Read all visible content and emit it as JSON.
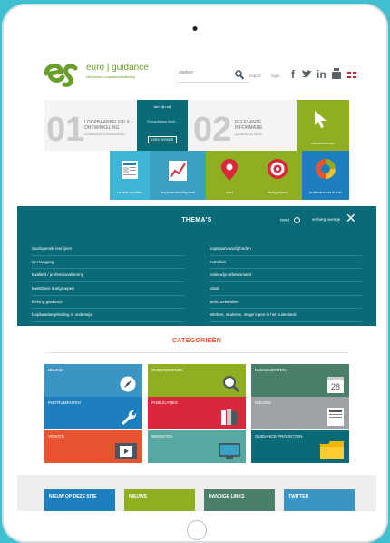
{
  "header": {
    "logo_brand": "euro",
    "logo_brand2": "guidance",
    "logo_sub": "Nederlands Loopbaanontwikkeling",
    "search_placeholder": "zoeken",
    "nav_export": "export",
    "nav_login": "login",
    "social": [
      "f",
      "t",
      "in",
      "yt"
    ]
  },
  "hero": {
    "num1": "01",
    "label1": "LOOPBAANBELEID & -ONTWIKKELING",
    "sub1": "Ontwikkelingen in loopbaanbeleid",
    "who_title": "wie zijn wij",
    "who_text": "Euroguidance biedt...",
    "read_more": "LEES VERDER",
    "num2": "02",
    "label2": "RELEVANTE INFORMATIE",
    "sub2": "gerelateerd per thema",
    "tile_nieuws": "nieuwsbrieven",
    "tile_updates": "Laatste updates",
    "tile_chart": "loopbaankennisportal",
    "tile_pin": "doel",
    "tile_target": "doelgroepen",
    "tile_ring": "professioneel in info"
  },
  "themas": {
    "title": "THEMA'S",
    "reset": "reset",
    "hide": "verberg overige",
    "left": [
      "doorlopende leerlijnen",
      "ict / toegang",
      "kwaliteit / professionalisering",
      "kwetsbare doelgroepen",
      "lifelong guidance",
      "loopbaanbegeleiding in onderwijs"
    ],
    "right": [
      "loopbaanvaardigheden",
      "mobiliteit",
      "onderwijs-arbeidsmarkt",
      "uitval",
      "werkzoekenden",
      "Werken, studeren, stage lopen in het buitenland"
    ]
  },
  "categories": {
    "title": "CATEGORIEËN",
    "items": [
      {
        "label": "BELEID",
        "color": "#3a95c4",
        "icon": "compass-icon"
      },
      {
        "label": "ONDERZOEKEN",
        "color": "#8fae22",
        "icon": "magnifier-icon"
      },
      {
        "label": "EVENEMENTEN",
        "color": "#4a7f6a",
        "icon": "calendar-icon"
      },
      {
        "label": "INSTRUMENTEN",
        "color": "#1e7fbf",
        "icon": "wrench-icon"
      },
      {
        "label": "PUBLICATIES",
        "color": "#d9273b",
        "icon": "books-icon"
      },
      {
        "label": "NIEUWS",
        "color": "#9ea2a6",
        "icon": "newspaper-icon"
      },
      {
        "label": "VIDEO'S",
        "color": "#e8542f",
        "icon": "film-icon"
      },
      {
        "label": "WEBSITES",
        "color": "#56a8a0",
        "icon": "monitor-icon"
      },
      {
        "label": "GUIDANCE-PROJECTEN",
        "color": "#0a6a78",
        "icon": "folder-icon"
      }
    ],
    "calendar_day": "28"
  },
  "bottom": {
    "tabs": [
      {
        "label": "NIEUW OP DEZE SITE",
        "color": "#1e7fbf"
      },
      {
        "label": "NIEUWS",
        "color": "#8fae22"
      },
      {
        "label": "HANDIGE LINKS",
        "color": "#4a7f6a"
      },
      {
        "label": "TWITTER",
        "color": "#3a95c4"
      }
    ]
  }
}
